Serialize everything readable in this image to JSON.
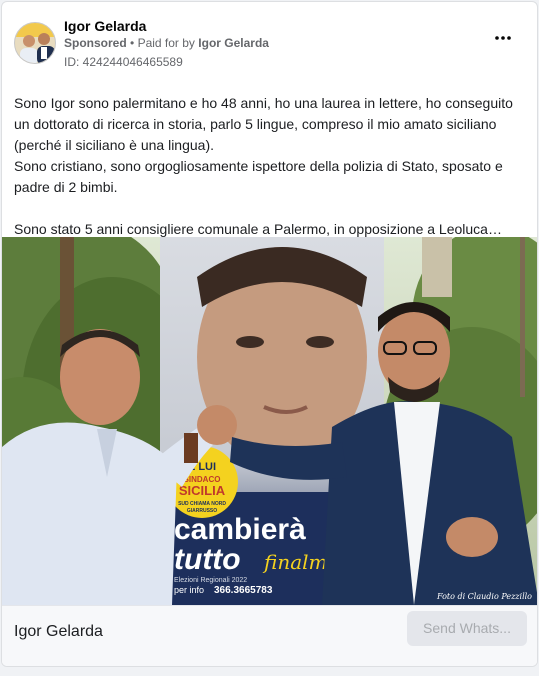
{
  "ad": {
    "page_name": "Igor Gelarda",
    "sponsored": "Sponsored",
    "separator": "•",
    "paid_for_prefix": "Paid for by",
    "paid_for_name": "Igor Gelarda",
    "ad_id": "ID: 424244046465589",
    "more_icon": "more-horizontal-icon"
  },
  "body": {
    "paragraph1": "Sono Igor sono palermitano e ho 48 anni, ho una laurea in lettere, ho conseguito un dottorato di ricerca in storia, parlo 5 lingue, compreso il mio amato siciliano (perché il siciliano è una lingua).",
    "paragraph2": "Sono cristiano, sono orgogliosamente ispettore della polizia di Stato, sposato e padre di 2 bimbi.",
    "paragraph3": "Sono stato 5 anni consigliere comunale a Palermo, in opposizione a Leoluca…"
  },
  "photo": {
    "poster_headline": "cambierà",
    "poster_subheadline": "tutto",
    "poster_script": "finalmente",
    "poster_elections": "Elezioni Regionali 2022",
    "poster_info_prefix": "per info",
    "poster_phone": "366.3665783",
    "badge_line1": "E LUI",
    "badge_line2": "SINDACO",
    "badge_line3": "SICILIA",
    "badge_line4": "SUD CHIAMA NORD",
    "badge_line5": "GIARRUSSO",
    "credit": "Foto di Claudio Pezzillo"
  },
  "footer": {
    "title": "Igor Gelarda",
    "cta_label": "Send Whats..."
  },
  "colors": {
    "secondary_text": "#65676b",
    "cta_bg": "#e4e6eb",
    "cta_text": "#a8abaf"
  }
}
